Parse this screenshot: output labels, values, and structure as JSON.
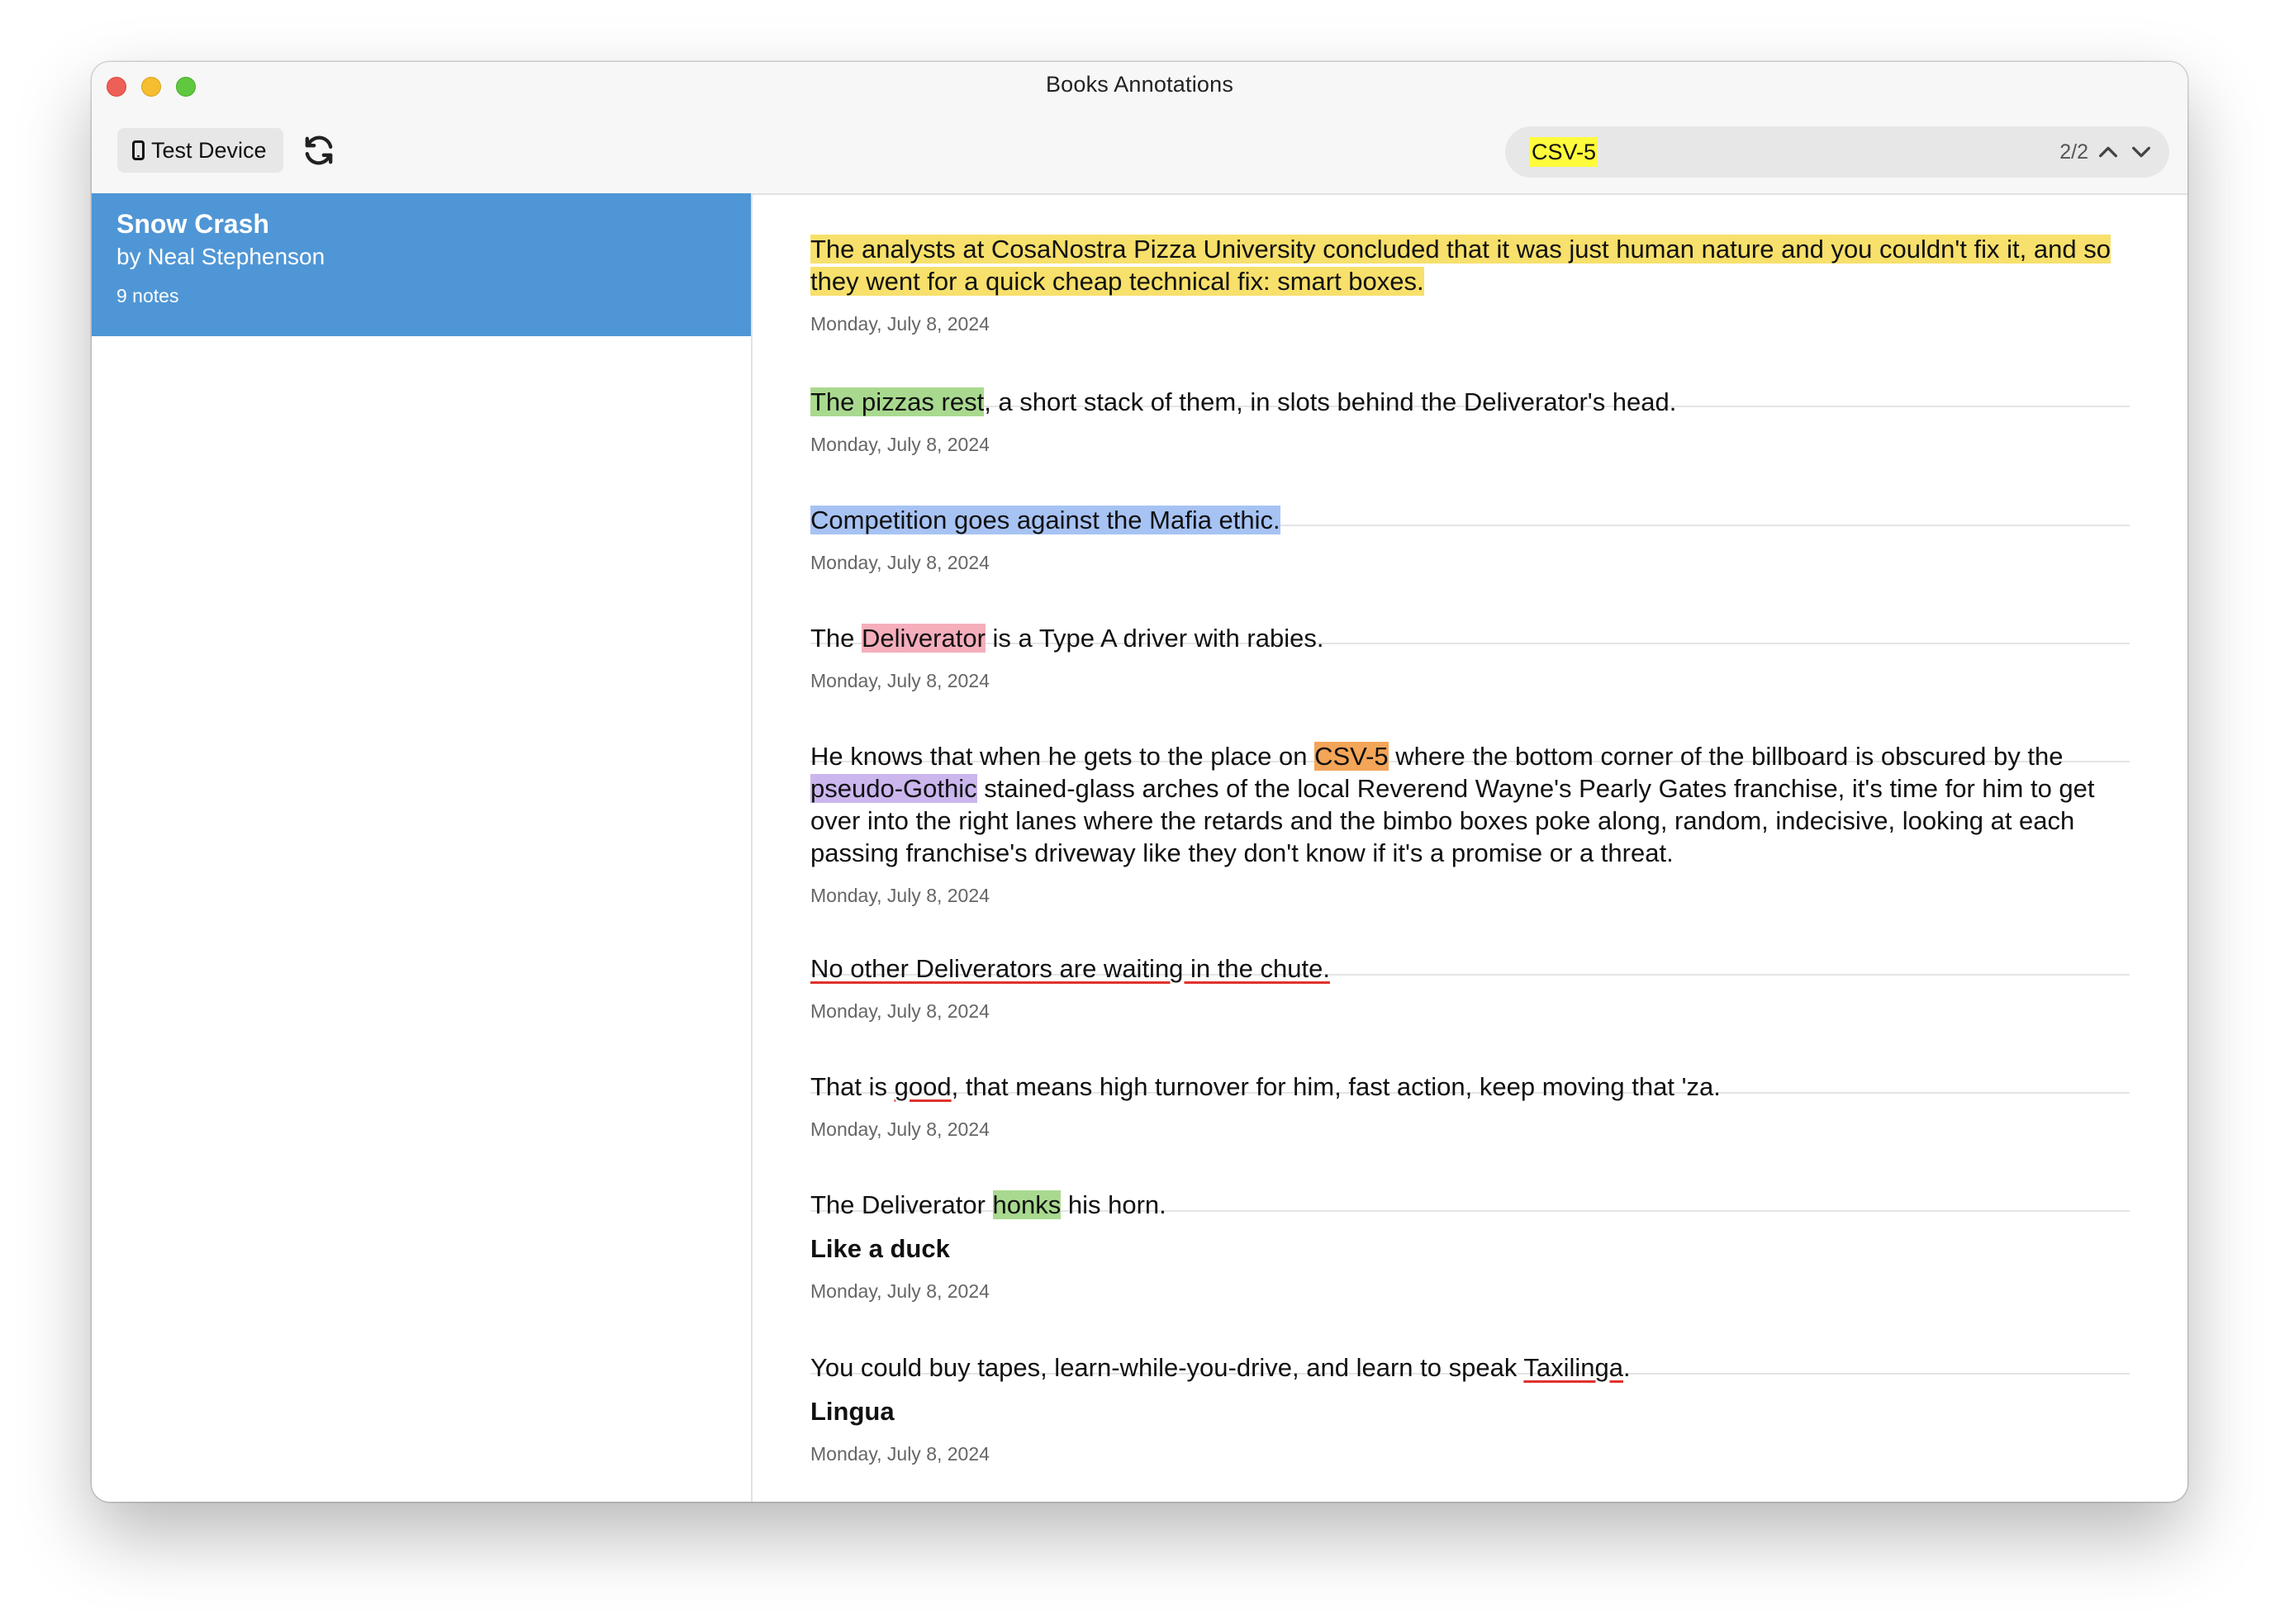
{
  "window": {
    "title": "Books Annotations"
  },
  "toolbar": {
    "device_label": "Test Device"
  },
  "search": {
    "value": "CSV-5",
    "count": "2/2"
  },
  "sidebar": {
    "books": [
      {
        "title": "Snow Crash",
        "author": "by Neal Stephenson",
        "notes_count": "9 notes"
      }
    ]
  },
  "colors": {
    "selection": "#4f96d6",
    "highlight_yellow": "#f7e06b",
    "highlight_green": "#a9d98f",
    "highlight_blue": "#a7c3f4",
    "highlight_pink": "#f5aebb",
    "highlight_purple": "#cbb6ee",
    "highlight_orange": "#f3a558",
    "underline_red": "#e0322c",
    "search_match": "#fffb3c"
  },
  "notes": [
    {
      "segments": [
        {
          "text": "The analysts at CosaNostra Pizza University concluded that it was just human nature and you couldn't fix it, and so they went for a quick cheap technical fix: smart boxes.",
          "style": "yellow"
        }
      ],
      "date": "Monday, July 8, 2024"
    },
    {
      "segments": [
        {
          "text": "The pizzas rest",
          "style": "green"
        },
        {
          "text": ", a short stack of them, in slots behind the Deliverator's head.",
          "style": ""
        }
      ],
      "date": "Monday, July 8, 2024"
    },
    {
      "segments": [
        {
          "text": "Competition goes against the Mafia ethic.",
          "style": "blue"
        }
      ],
      "date": "Monday, July 8, 2024"
    },
    {
      "segments": [
        {
          "text": "The ",
          "style": ""
        },
        {
          "text": "Deliverator",
          "style": "pink"
        },
        {
          "text": " is a Type A driver with rabies.",
          "style": ""
        }
      ],
      "date": "Monday, July 8, 2024"
    },
    {
      "segments": [
        {
          "text": "He knows that when he gets to the place on ",
          "style": ""
        },
        {
          "text": "CSV-5",
          "style": "orange"
        },
        {
          "text": " where the bottom corner of the billboard is obscured by the ",
          "style": ""
        },
        {
          "text": "pseudo-Gothic",
          "style": "purple"
        },
        {
          "text": " stained-glass arches of the local Reverend Wayne's Pearly Gates franchise, it's time for him to get over into the right lanes where the retards and the bimbo boxes poke along, random, indecisive, looking at each passing franchise's driveway like they don't know if it's a promise or a threat.",
          "style": ""
        }
      ],
      "date": "Monday, July 8, 2024"
    },
    {
      "segments": [
        {
          "text": "No other Deliverators are waiting in the chute.",
          "style": "underline"
        }
      ],
      "date": "Monday, July 8, 2024"
    },
    {
      "segments": [
        {
          "text": "That is ",
          "style": ""
        },
        {
          "text": "good",
          "style": "underline"
        },
        {
          "text": ", that means high turnover for him, fast action, keep moving that 'za.",
          "style": ""
        }
      ],
      "date": "Monday, July 8, 2024"
    },
    {
      "segments": [
        {
          "text": "The Deliverator ",
          "style": ""
        },
        {
          "text": "honks",
          "style": "green"
        },
        {
          "text": " his horn.",
          "style": ""
        }
      ],
      "comment": "Like a duck",
      "date": "Monday, July 8, 2024"
    },
    {
      "segments": [
        {
          "text": "You could buy tapes, learn-while-you-drive, and learn to speak ",
          "style": ""
        },
        {
          "text": "Taxilinga",
          "style": "underline"
        },
        {
          "text": ".",
          "style": ""
        }
      ],
      "comment": "Lingua",
      "date": "Monday, July 8, 2024"
    }
  ]
}
